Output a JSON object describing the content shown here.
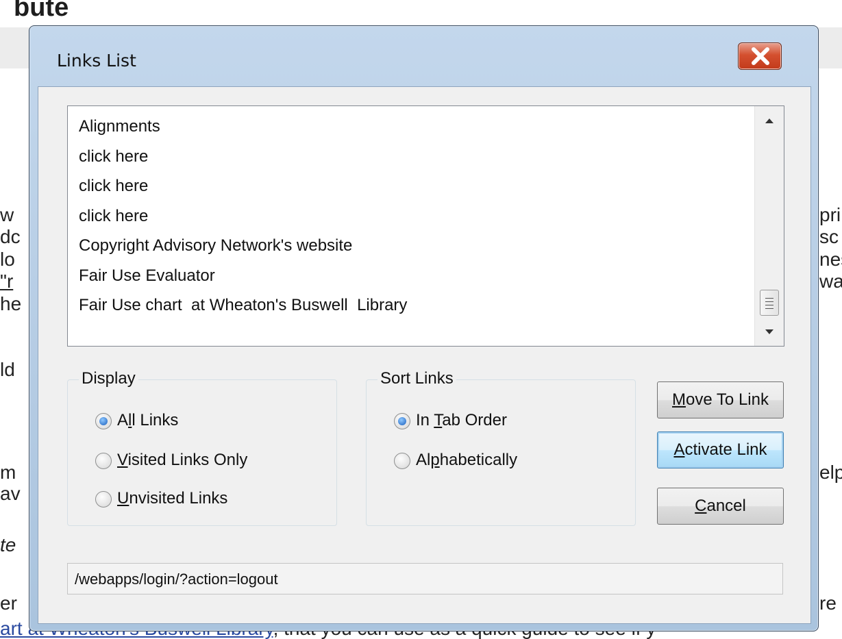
{
  "background": {
    "heading": "bute",
    "left_fragments": [
      "w",
      "dc",
      "lo",
      "\"r",
      "he",
      "ld",
      "m",
      "av",
      "te",
      "er"
    ],
    "right_fragments": [
      "prir",
      "sc",
      "nes",
      "wa",
      "elp",
      "re"
    ],
    "bottom_line_link": "art  at Wheaton's Buswell Library",
    "bottom_line_text": ", that you can use as a quick guide to see if y"
  },
  "dialog": {
    "title": "Links List",
    "links": [
      "Alignments",
      "click here",
      "click here",
      "click here",
      "Copyright Advisory Network's website",
      "Fair Use Evaluator",
      "Fair Use chart  at Wheaton's Buswell  Library"
    ],
    "display": {
      "label": "Display",
      "options": [
        {
          "pre": "A",
          "key": "l",
          "post": "l Links",
          "selected": true
        },
        {
          "pre": "",
          "key": "V",
          "post": "isited Links Only",
          "selected": false
        },
        {
          "pre": "",
          "key": "U",
          "post": "nvisited Links",
          "selected": false
        }
      ]
    },
    "sort": {
      "label": "Sort Links",
      "options": [
        {
          "pre": "In ",
          "key": "T",
          "post": "ab Order",
          "selected": true
        },
        {
          "pre": "Al",
          "key": "p",
          "post": "habetically",
          "selected": false
        }
      ]
    },
    "buttons": {
      "move": {
        "key": "M",
        "rest": "ove To Link"
      },
      "activate": {
        "key": "A",
        "rest": "ctivate Link"
      },
      "cancel": {
        "key": "C",
        "rest": "ancel"
      }
    },
    "status_url": "/webapps/login/?action=logout"
  },
  "icons": {
    "close": "close-icon",
    "scroll_up": "chevron-up-icon",
    "scroll_down": "chevron-down-icon",
    "scroll_thumb": "scroll-grip-icon"
  },
  "colors": {
    "title_bar": "#b4cbe3",
    "close_button": "#c23a1b",
    "default_button_border": "#3c7fb1"
  }
}
